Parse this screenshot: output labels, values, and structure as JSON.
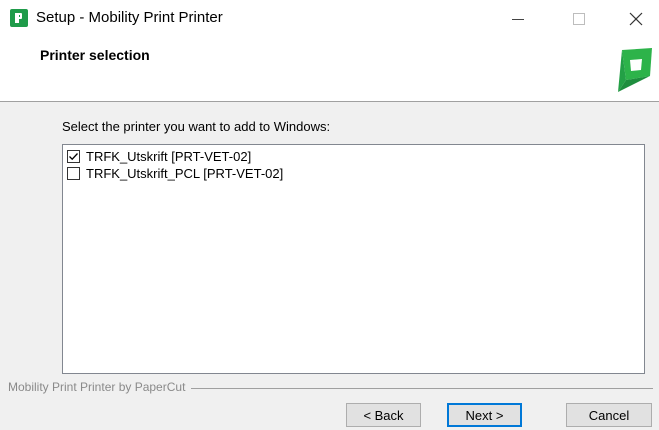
{
  "window": {
    "title": "Setup - Mobility Print Printer",
    "icon": "papercut-app-icon"
  },
  "header": {
    "title": "Printer selection",
    "logo": "papercut-logo",
    "brand_color": "#1f9b4a"
  },
  "main": {
    "instruction": "Select the printer you want to add to Windows:",
    "printers": [
      {
        "label": "TRFK_Utskrift [PRT-VET-02]",
        "checked": true
      },
      {
        "label": "TRFK_Utskrift_PCL [PRT-VET-02]",
        "checked": false
      }
    ]
  },
  "footer": {
    "branding": "Mobility Print Printer by PaperCut",
    "back_label": "< Back",
    "next_label": "Next >",
    "cancel_label": "Cancel"
  },
  "colors": {
    "accent": "#0078d7",
    "dialog_background": "#f0f0f0"
  }
}
